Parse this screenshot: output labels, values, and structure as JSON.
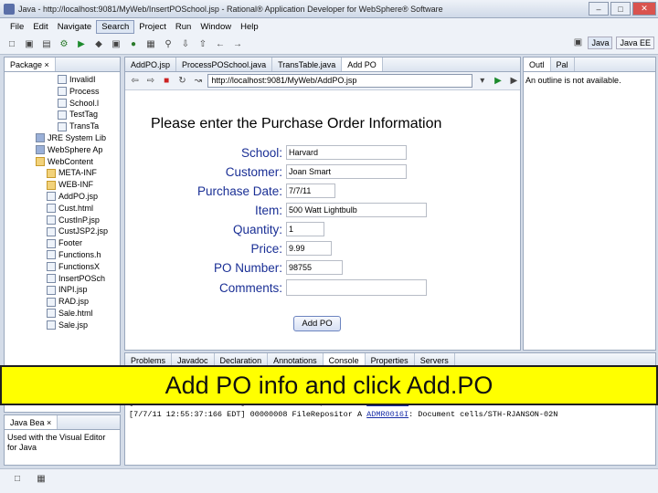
{
  "window": {
    "title": "Java - http://localhost:9081/MyWeb/InsertPOSchool.jsp - Rational® Application Developer for WebSphere® Software"
  },
  "menu": [
    "File",
    "Edit",
    "Navigate",
    "Search",
    "Project",
    "Run",
    "Window",
    "Help"
  ],
  "perspectives": {
    "java": "Java",
    "javaee": "Java EE"
  },
  "left_panel": {
    "tab_label": "Package",
    "tree": [
      {
        "label": "InvalidI",
        "icon": "jsp-file-icon"
      },
      {
        "label": "Process",
        "icon": "jsp-file-icon"
      },
      {
        "label": "School.l",
        "icon": "jsp-file-icon"
      },
      {
        "label": "TestTag",
        "icon": "jsp-file-icon"
      },
      {
        "label": "TransTa",
        "icon": "jsp-file-icon"
      },
      {
        "label": "JRE System Lib",
        "icon": "library-icon"
      },
      {
        "label": "WebSphere Ap",
        "icon": "library-icon"
      },
      {
        "label": "WebContent",
        "icon": "folder-icon"
      },
      {
        "label": "META-INF",
        "icon": "folder-icon"
      },
      {
        "label": "WEB-INF",
        "icon": "folder-icon"
      },
      {
        "label": "AddPO.jsp",
        "icon": "jsp-file-icon"
      },
      {
        "label": "Cust.html",
        "icon": "html-file-icon"
      },
      {
        "label": "CustInP.jsp",
        "icon": "jsp-file-icon"
      },
      {
        "label": "CustJSP2.jsp",
        "icon": "jsp-file-icon"
      },
      {
        "label": "Footer",
        "icon": "jsp-file-icon"
      },
      {
        "label": "Functions.h",
        "icon": "html-file-icon"
      },
      {
        "label": "FunctionsX",
        "icon": "html-file-icon"
      },
      {
        "label": "InsertPOSch",
        "icon": "jsp-file-icon"
      },
      {
        "label": "INPI.jsp",
        "icon": "jsp-file-icon"
      },
      {
        "label": "RAD.jsp",
        "icon": "jsp-file-icon"
      },
      {
        "label": "Sale.html",
        "icon": "html-file-icon"
      },
      {
        "label": "Sale.jsp",
        "icon": "jsp-file-icon"
      }
    ]
  },
  "editor_tabs": [
    "AddPO.jsp",
    "ProcessPOSchool.java",
    "TransTable.java",
    "Add PO"
  ],
  "browser": {
    "url": "http://localhost:9081/MyWeb/AddPO.jsp"
  },
  "form": {
    "title": "Please enter the Purchase Order Information",
    "fields": [
      {
        "label": "School:",
        "value": "Harvard"
      },
      {
        "label": "Customer:",
        "value": "Joan Smart"
      },
      {
        "label": "Purchase Date:",
        "value": "7/7/11"
      },
      {
        "label": "Item:",
        "value": "500 Watt Lightbulb"
      },
      {
        "label": "Quantity:",
        "value": "1"
      },
      {
        "label": "Price:",
        "value": "9.99"
      },
      {
        "label": "PO Number:",
        "value": "98755"
      },
      {
        "label": "Comments:",
        "value": ""
      }
    ],
    "submit": "Add PO"
  },
  "right_panel": {
    "tabs": [
      "Outl",
      "Pal"
    ],
    "message": "An outline is not available."
  },
  "bottom_tabs": [
    "Problems",
    "Javadoc",
    "Declaration",
    "Annotations",
    "Console",
    "Properties",
    "Servers"
  ],
  "console": [
    {
      "text": "[7/7/11 12:55:37:166 EDT] 00000008 FileRepositor A  ",
      "link": "ADMR0016I",
      "rest": ": Document cells/STH-RJANSON-02N"
    },
    {
      "text": "[7/7/11 12:55:37:166 EDT] 00000008 FileRepositor A  ",
      "link": "ADMR0016I",
      "rest": ": Document cells/STH-RJANSON-02N"
    }
  ],
  "lower_left": {
    "tab_label": "Java Bea",
    "message": "Used with the Visual Editor for Java"
  },
  "banner": {
    "text": "Add PO info and click Add.PO",
    "color": "#ffff00"
  }
}
